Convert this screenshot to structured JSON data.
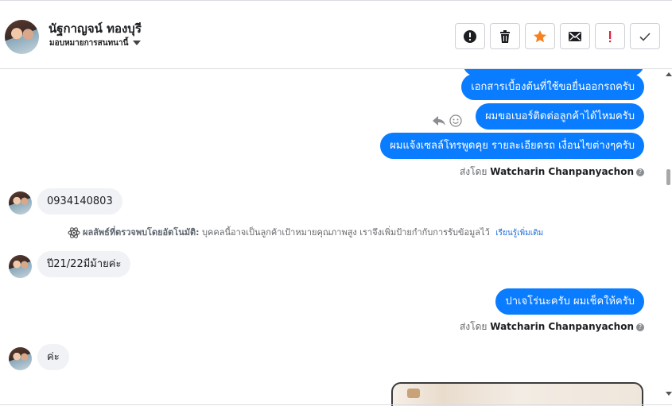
{
  "header": {
    "contact_name": "นัฐกาญจน์ ทองบุรี",
    "assign_label": "มอบหมายการสนทนานี้",
    "toolbar": [
      {
        "name": "report-button",
        "icon": "alert-circle-icon"
      },
      {
        "name": "delete-button",
        "icon": "trash-icon"
      },
      {
        "name": "star-button",
        "icon": "star-icon"
      },
      {
        "name": "mark-unread-button",
        "icon": "envelope-icon"
      },
      {
        "name": "spam-button",
        "icon": "exclamation-icon"
      },
      {
        "name": "done-button",
        "icon": "check-icon"
      }
    ]
  },
  "colors": {
    "outgoing_bubble": "#0a7cff",
    "incoming_bubble": "#f0f2f5",
    "star": "#f5821f",
    "spam": "#e41e3f"
  },
  "messages": {
    "out_1": "เอกสารเบื้องต้นที่ใช้ขอยื่นออกรถครับ",
    "out_2": "ผมขอเบอร์ติดต่อลูกค้าได้ไหมครับ",
    "out_3": "ผมแจ้งเซลล์โทรพูดคุย รายละเอียดรถ เงื่อนไขต่างๆครับ",
    "sent_by_prefix_1": "ส่งโดย",
    "sent_by_name_1": "Watcharin Chanpanyachon",
    "in_1": "0934140803",
    "auto_note_label": "ผลลัพธ์ที่ตรวจพบโดยอัตโนมัติ:",
    "auto_note_text": "บุคคลนี้อาจเป็นลูกค้าเป้าหมายคุณภาพสูง เราจึงเพิ่มป้ายกำกับการรับข้อมูลไว้",
    "auto_note_link": "เรียนรู้เพิ่มเติม",
    "in_2": "ปี21/22มีม้ายค่ะ",
    "out_4": "ปาเจโร่นะครับ ผมเช็คให้ครับ",
    "sent_by_prefix_2": "ส่งโดย",
    "sent_by_name_2": "Watcharin Chanpanyachon",
    "in_3": "ค่ะ",
    "help_glyph": "?"
  }
}
